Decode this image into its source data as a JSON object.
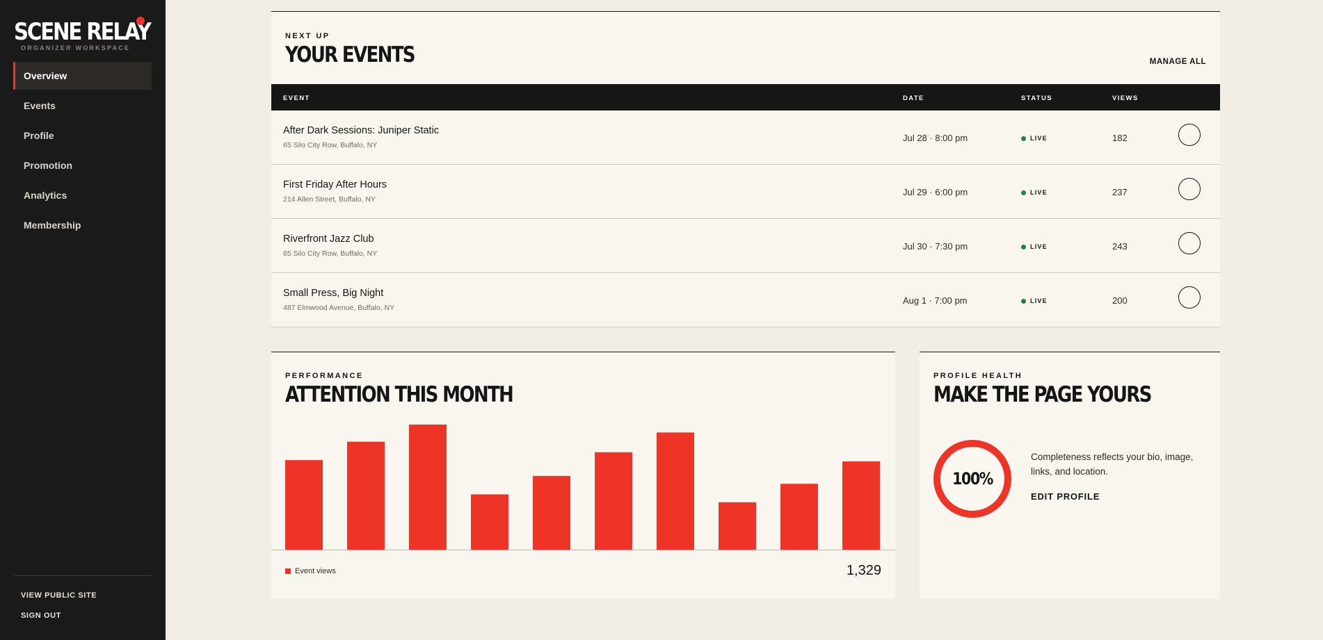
{
  "brand": {
    "name": "SCENE RELAY",
    "subtitle": "ORGANIZER WORKSPACE"
  },
  "sidebar": {
    "items": [
      {
        "label": "Overview",
        "active": true
      },
      {
        "label": "Events"
      },
      {
        "label": "Profile"
      },
      {
        "label": "Promotion"
      },
      {
        "label": "Analytics"
      },
      {
        "label": "Membership"
      }
    ],
    "view_public_site": "VIEW PUBLIC SITE",
    "sign_out": "SIGN OUT"
  },
  "events_panel": {
    "eyebrow": "NEXT UP",
    "title": "YOUR EVENTS",
    "manage_all": "MANAGE ALL",
    "columns": {
      "event": "EVENT",
      "date": "DATE",
      "status": "STATUS",
      "views": "VIEWS"
    },
    "rows": [
      {
        "name": "After Dark Sessions: Juniper Static",
        "address": "65 Silo City Row, Buffalo, NY",
        "date": "Jul 28 · 8:00 pm",
        "status": "LIVE",
        "views": "182"
      },
      {
        "name": "First Friday After Hours",
        "address": "214 Allen Street, Buffalo, NY",
        "date": "Jul 29 · 6:00 pm",
        "status": "LIVE",
        "views": "237"
      },
      {
        "name": "Riverfront Jazz Club",
        "address": "65 Silo City Row, Buffalo, NY",
        "date": "Jul 30 · 7:30 pm",
        "status": "LIVE",
        "views": "243"
      },
      {
        "name": "Small Press, Big Night",
        "address": "487 Elmwood Avenue, Buffalo, NY",
        "date": "Aug 1 · 7:00 pm",
        "status": "LIVE",
        "views": "200"
      }
    ],
    "status_color": "#2a7d46"
  },
  "performance_panel": {
    "eyebrow": "PERFORMANCE",
    "title": "ATTENTION THIS MONTH",
    "legend_label": "Event views",
    "total": "1,329"
  },
  "chart_data": {
    "type": "bar",
    "values": [
      68,
      82,
      95,
      42,
      56,
      74,
      89,
      36,
      50,
      67
    ],
    "ylim": [
      0,
      95
    ],
    "series": [
      {
        "name": "Event views"
      }
    ],
    "grid": false,
    "color": "#ee3327"
  },
  "health_panel": {
    "eyebrow": "PROFILE HEALTH",
    "title": "MAKE THE PAGE YOURS",
    "percent": "100%",
    "completeness": 1.0,
    "description": "Completeness reflects your bio, image, links, and location.",
    "edit_label": "EDIT PROFILE"
  },
  "colors": {
    "accent": "#ee3327",
    "sidebar": "#1a1a1a",
    "page": "#f2eee6",
    "panel": "#f9f6ef"
  }
}
